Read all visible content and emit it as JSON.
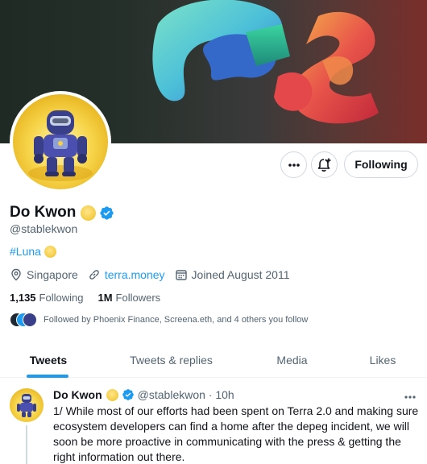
{
  "profile": {
    "display_name": "Do Kwon",
    "handle": "@stablekwon",
    "bio_hashtag": "#Luna",
    "location": "Singapore",
    "website": "terra.money",
    "joined": "Joined August 2011",
    "following_count": "1,135",
    "following_label": "Following",
    "followers_count": "1M",
    "followers_label": "Followers",
    "followed_by": "Followed by Phoenix Finance, Screena.eth, and 4 others you follow"
  },
  "actions": {
    "following_button": "Following",
    "icons": [
      "more-icon",
      "notification-bell-icon"
    ]
  },
  "tabs": [
    {
      "label": "Tweets",
      "active": true
    },
    {
      "label": "Tweets & replies",
      "active": false
    },
    {
      "label": "Media",
      "active": false
    },
    {
      "label": "Likes",
      "active": false
    }
  ],
  "tweet": {
    "name": "Do Kwon",
    "handle_time": "@stablekwon · 10h",
    "text": "1/ While most of our efforts had been spent on Terra 2.0 and making sure ecosystem developers can find a home after the depeg incident, we will soon be more proactive in communicating with the press & getting the right information out there."
  },
  "colors": {
    "accent": "#1d9bf0",
    "text_primary": "#0f1419",
    "text_secondary": "#536471",
    "coin": "#f5cf4a"
  }
}
